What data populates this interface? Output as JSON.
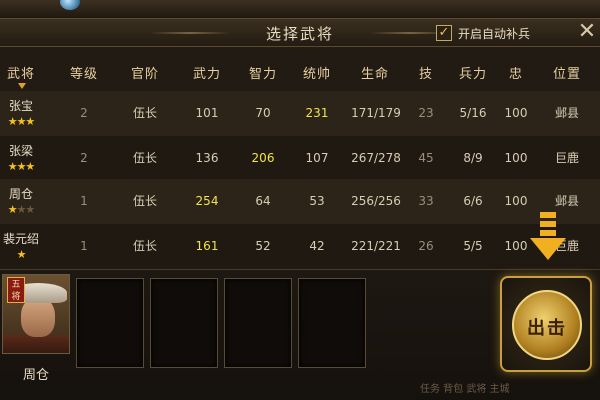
{
  "title": "选择武将",
  "auto_replenish": {
    "label": "开启自动补兵",
    "checked": true,
    "check_glyph": "✓"
  },
  "close_glyph": "✕",
  "columns": [
    "武将",
    "等级",
    "官阶",
    "武力",
    "智力",
    "统帅",
    "生命",
    "技",
    "兵力",
    "忠",
    "位置"
  ],
  "rows": [
    {
      "name": "张宝",
      "stars": 3,
      "level": "2",
      "rank": "伍长",
      "force": "101",
      "intellect": "70",
      "command": "231",
      "hp": "171/179",
      "skill": "23",
      "troops": "5/16",
      "loyalty": "100",
      "location": "邺县",
      "highlight": "command"
    },
    {
      "name": "张梁",
      "stars": 3,
      "level": "2",
      "rank": "伍长",
      "force": "136",
      "intellect": "206",
      "command": "107",
      "hp": "267/278",
      "skill": "45",
      "troops": "8/9",
      "loyalty": "100",
      "location": "巨鹿",
      "highlight": "intellect"
    },
    {
      "name": "周仓",
      "stars": 3,
      "stars_dim": 2,
      "level": "1",
      "rank": "伍长",
      "force": "254",
      "intellect": "64",
      "command": "53",
      "hp": "256/256",
      "skill": "33",
      "troops": "6/6",
      "loyalty": "100",
      "location": "邺县",
      "highlight": "force"
    },
    {
      "name": "裴元绍",
      "stars": 1,
      "level": "1",
      "rank": "伍长",
      "force": "161",
      "intellect": "52",
      "command": "42",
      "hp": "221/221",
      "skill": "26",
      "troops": "5/5",
      "loyalty": "100",
      "location": "巨鹿",
      "highlight": "force"
    }
  ],
  "selected_general": {
    "name": "周仓",
    "badge": "五将"
  },
  "go_button": {
    "label": "出击"
  },
  "footer": "任务  背包  武将  主城",
  "colors": {
    "highlight": "#f2e24a",
    "star": "#f5c020",
    "accent": "#c8a040"
  }
}
